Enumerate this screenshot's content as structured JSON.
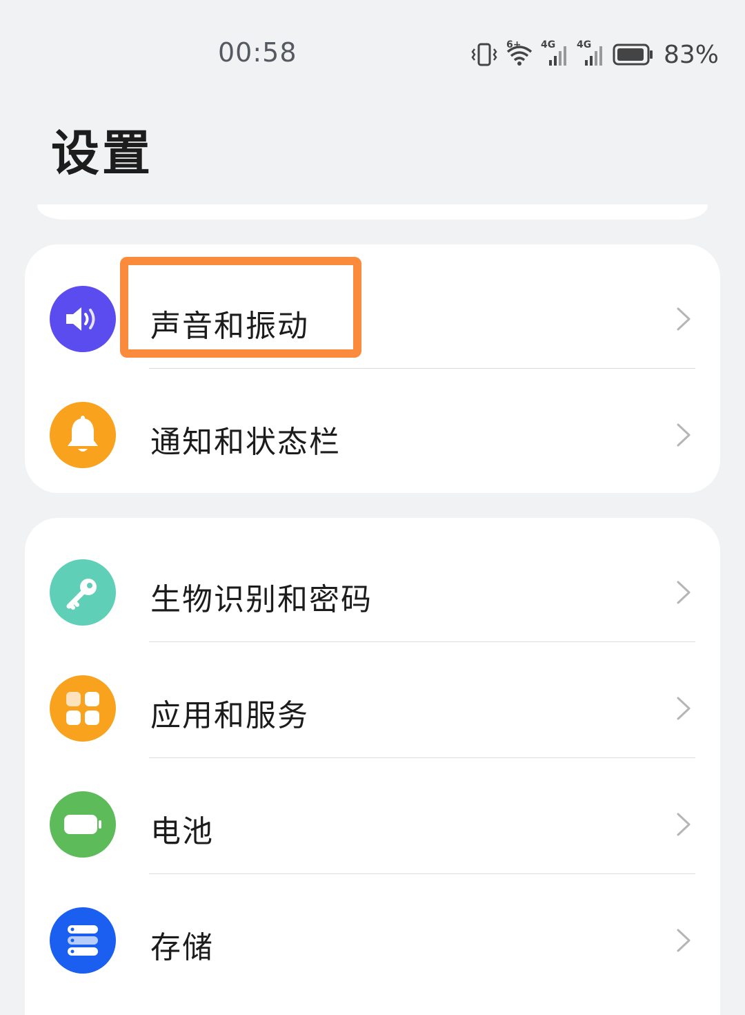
{
  "status_bar": {
    "time": "00:58",
    "network_labels": [
      "6+",
      "4G",
      "4G"
    ],
    "battery_percent": "83%",
    "icons": [
      "vibrate-icon",
      "wifi-icon",
      "signal-4g-icon",
      "signal-4g-icon",
      "battery-icon"
    ]
  },
  "page": {
    "title": "设置"
  },
  "groups": [
    {
      "items": [
        {
          "label": "声音和振动",
          "icon": "speaker-icon",
          "icon_color": "#5b4cf0",
          "highlighted": true
        },
        {
          "label": "通知和状态栏",
          "icon": "bell-icon",
          "icon_color": "#f8a21d"
        }
      ]
    },
    {
      "items": [
        {
          "label": "生物识别和密码",
          "icon": "key-icon",
          "icon_color": "#5fcfb8"
        },
        {
          "label": "应用和服务",
          "icon": "apps-grid-icon",
          "icon_color": "#f8a21d"
        },
        {
          "label": "电池",
          "icon": "battery-icon",
          "icon_color": "#5dbb5a"
        },
        {
          "label": "存储",
          "icon": "storage-icon",
          "icon_color": "#1a5ff0"
        }
      ]
    }
  ],
  "colors": {
    "background": "#f1f2f4",
    "card": "#ffffff",
    "highlight": "#fb8b3c"
  }
}
